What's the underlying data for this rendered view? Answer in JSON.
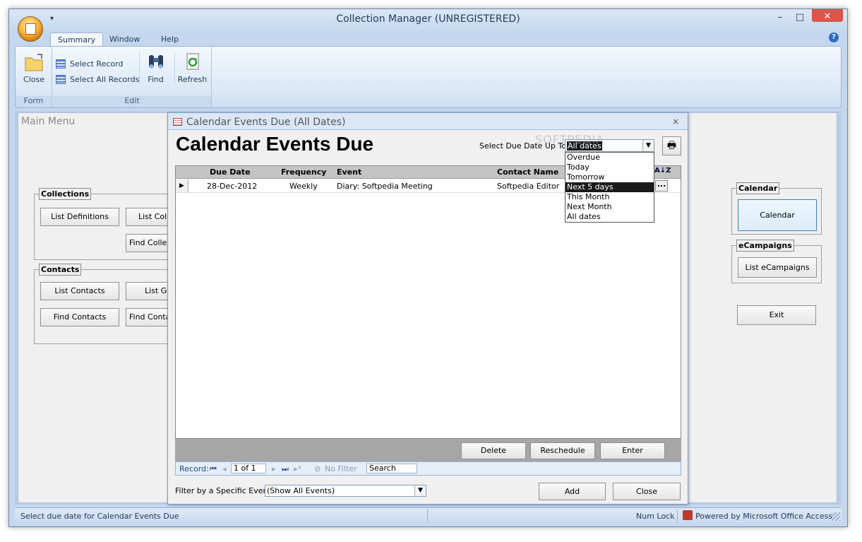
{
  "window": {
    "title": "Collection Manager (UNREGISTERED)",
    "qat": "▾",
    "min": "–",
    "max": "□",
    "close": "✕"
  },
  "ribbon": {
    "tabs": [
      {
        "label": "Summary"
      },
      {
        "label": "Window"
      },
      {
        "label": "Help"
      }
    ],
    "help": "?",
    "groups": {
      "form": {
        "label": "Form",
        "close": "Close"
      },
      "edit": {
        "label": "Edit",
        "select_record": "Select Record",
        "select_all": "Select All Records",
        "find": "Find",
        "refresh": "Refresh"
      }
    }
  },
  "main_menu": {
    "title": "Main Menu",
    "collections": {
      "label": "Collections",
      "list_definitions": "List Definitions",
      "list_collections": "List Colle",
      "find_collections": "Find Collect"
    },
    "contacts": {
      "label": "Contacts",
      "list_contacts": "List Contacts",
      "list_groups": "List Gro",
      "find_contacts": "Find Contacts",
      "find_contacts2": "Find Contac"
    },
    "calendar": {
      "label": "Calendar",
      "button": "Calendar"
    },
    "ecampaigns": {
      "label": "eCampaigns",
      "button": "List eCampaigns"
    },
    "exit": "Exit"
  },
  "dialog": {
    "title": "Calendar Events Due (All Dates)",
    "close": "×",
    "heading": "Calendar Events Due",
    "due_label": "Select Due Date Up To:",
    "due_value": "All dates",
    "print_icon": "🖶",
    "columns": [
      "Due Date",
      "Frequency",
      "Event",
      "Contact Name"
    ],
    "rows": [
      {
        "due": "28-Dec-2012",
        "freq": "Weekly",
        "event": "Diary: Softpedia Meeting",
        "contact": "Softpedia Editor"
      }
    ],
    "sort_icon": "A↓Z",
    "ellipsis": "...",
    "buttons": {
      "delete": "Delete",
      "reschedule": "Reschedule",
      "enter": "Enter"
    },
    "nav": {
      "record_label": "Record:",
      "first": "⏮",
      "prev": "◂",
      "position": "1 of 1",
      "next": "▸",
      "last": "⏭",
      "new": "▸*",
      "no_filter": "No Filter",
      "search": "Search"
    },
    "filter_label": "Filter by a Specific Event:",
    "filter_value": "(Show All Events)",
    "add": "Add",
    "close_btn": "Close"
  },
  "dropdown": {
    "options": [
      "Overdue",
      "Today",
      "Tomorrow",
      "Next 5 days",
      "This Month",
      "Next Month",
      "All dates"
    ],
    "highlighted": "Next 5 days"
  },
  "watermark": "SOFTPEDIA",
  "status": {
    "message": "Select due date for Calendar Events Due",
    "numlock": "Num Lock",
    "powered": "Powered by Microsoft Office Access"
  }
}
